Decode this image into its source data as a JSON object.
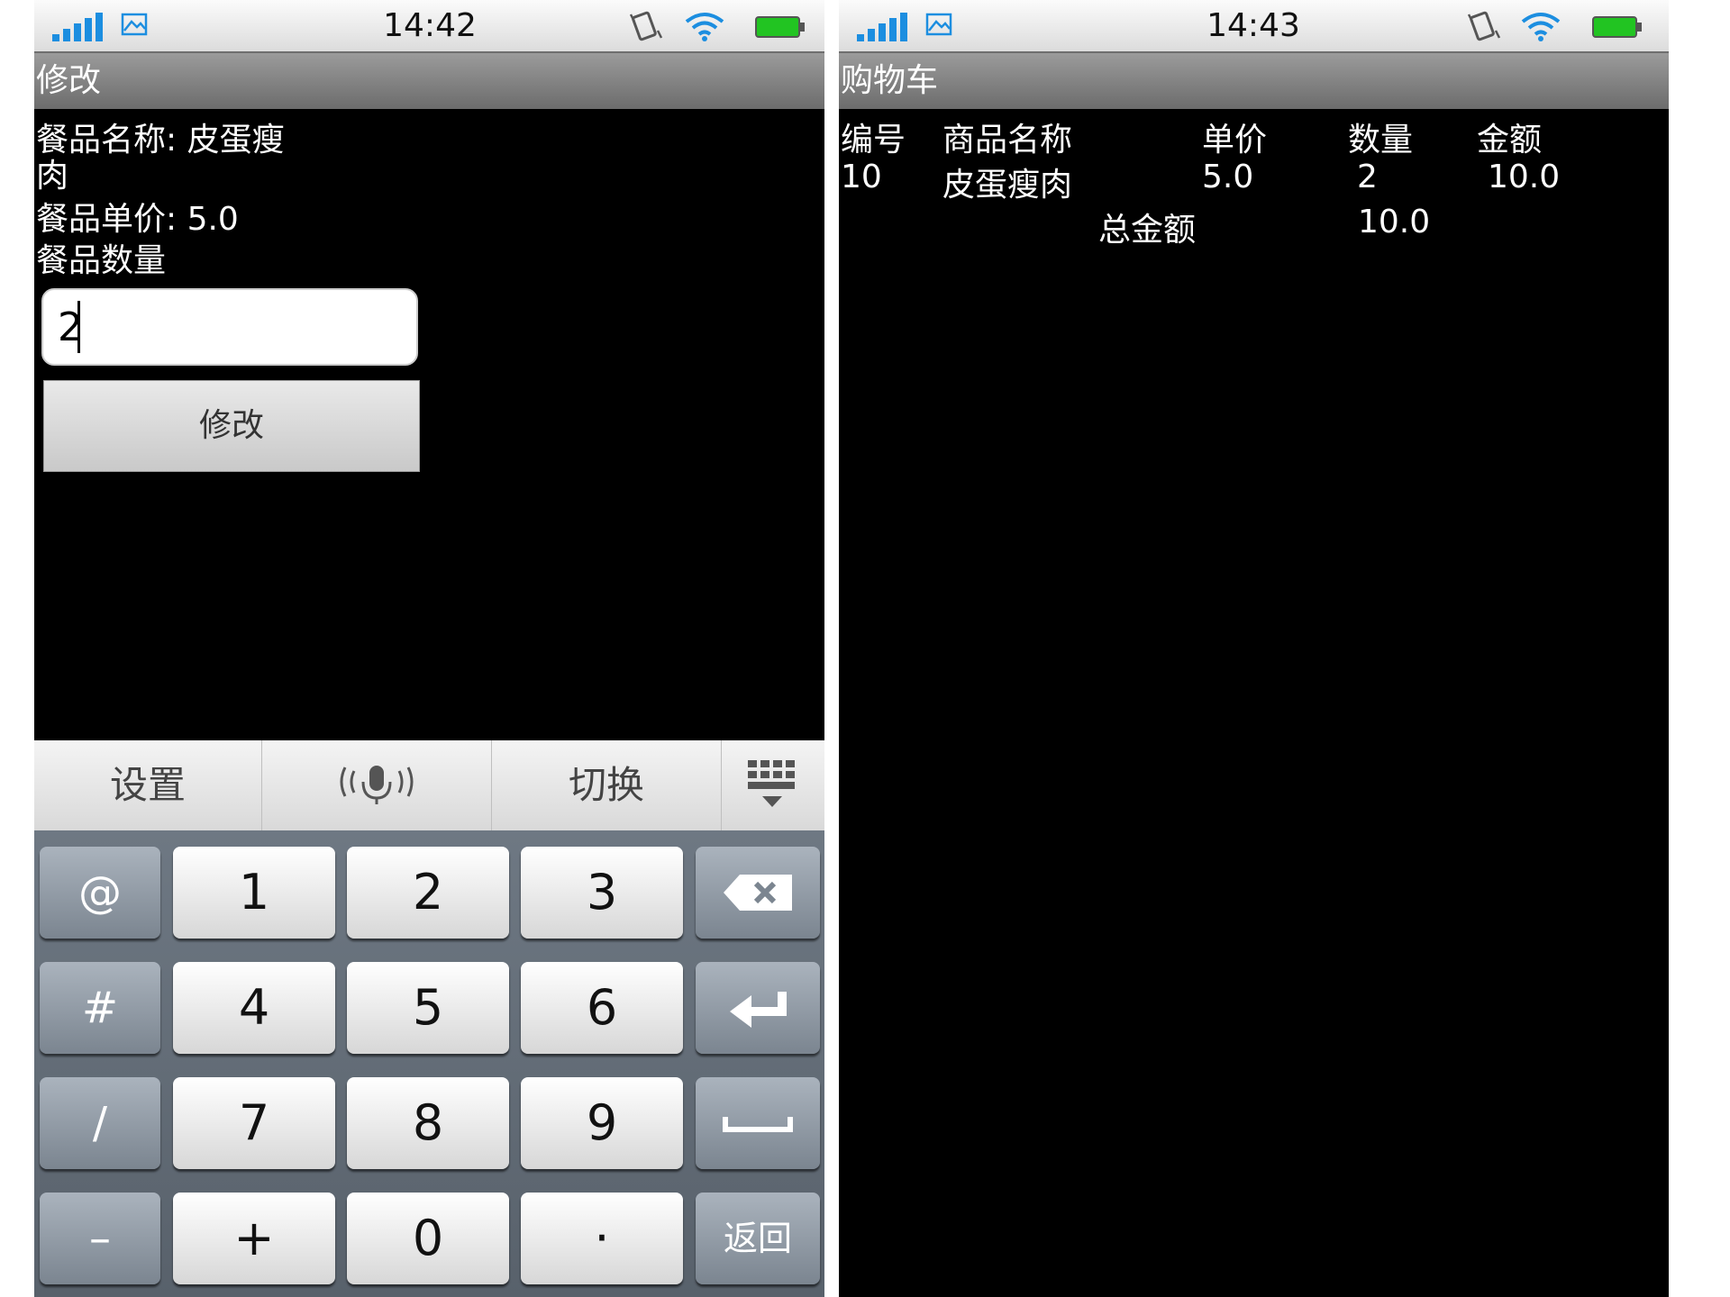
{
  "left": {
    "status": {
      "time": "14:42"
    },
    "title": "修改",
    "dish_name_label": "餐品名称: 皮蛋瘦",
    "dish_name_cont": "肉",
    "price_line": "餐品单价: 5.0",
    "qty_label": "餐品数量",
    "qty_value": "2",
    "modify_button": "修改",
    "kbd_toolbar": {
      "settings": "设置",
      "switch": "切换"
    },
    "keys": {
      "at": "@",
      "k1": "1",
      "k2": "2",
      "k3": "3",
      "hash": "#",
      "k4": "4",
      "k5": "5",
      "k6": "6",
      "slash": "/",
      "k7": "7",
      "k8": "8",
      "k9": "9",
      "minus": "–",
      "plus": "+",
      "k0": "0",
      "dot": "·",
      "back": "返回"
    }
  },
  "right": {
    "status": {
      "time": "14:43"
    },
    "title": "购物车",
    "headers": {
      "id": "编号",
      "name": "商品名称",
      "price": "单价",
      "qty": "数量",
      "amount": "金额"
    },
    "row": {
      "id": "10",
      "name": "皮蛋瘦肉",
      "price": "5.0",
      "qty": "2",
      "amount": "10.0"
    },
    "total_label": "总金额",
    "total_value": "10.0"
  },
  "colors": {
    "status_blue": "#1c8ee0",
    "battery_green": "#22c422"
  }
}
